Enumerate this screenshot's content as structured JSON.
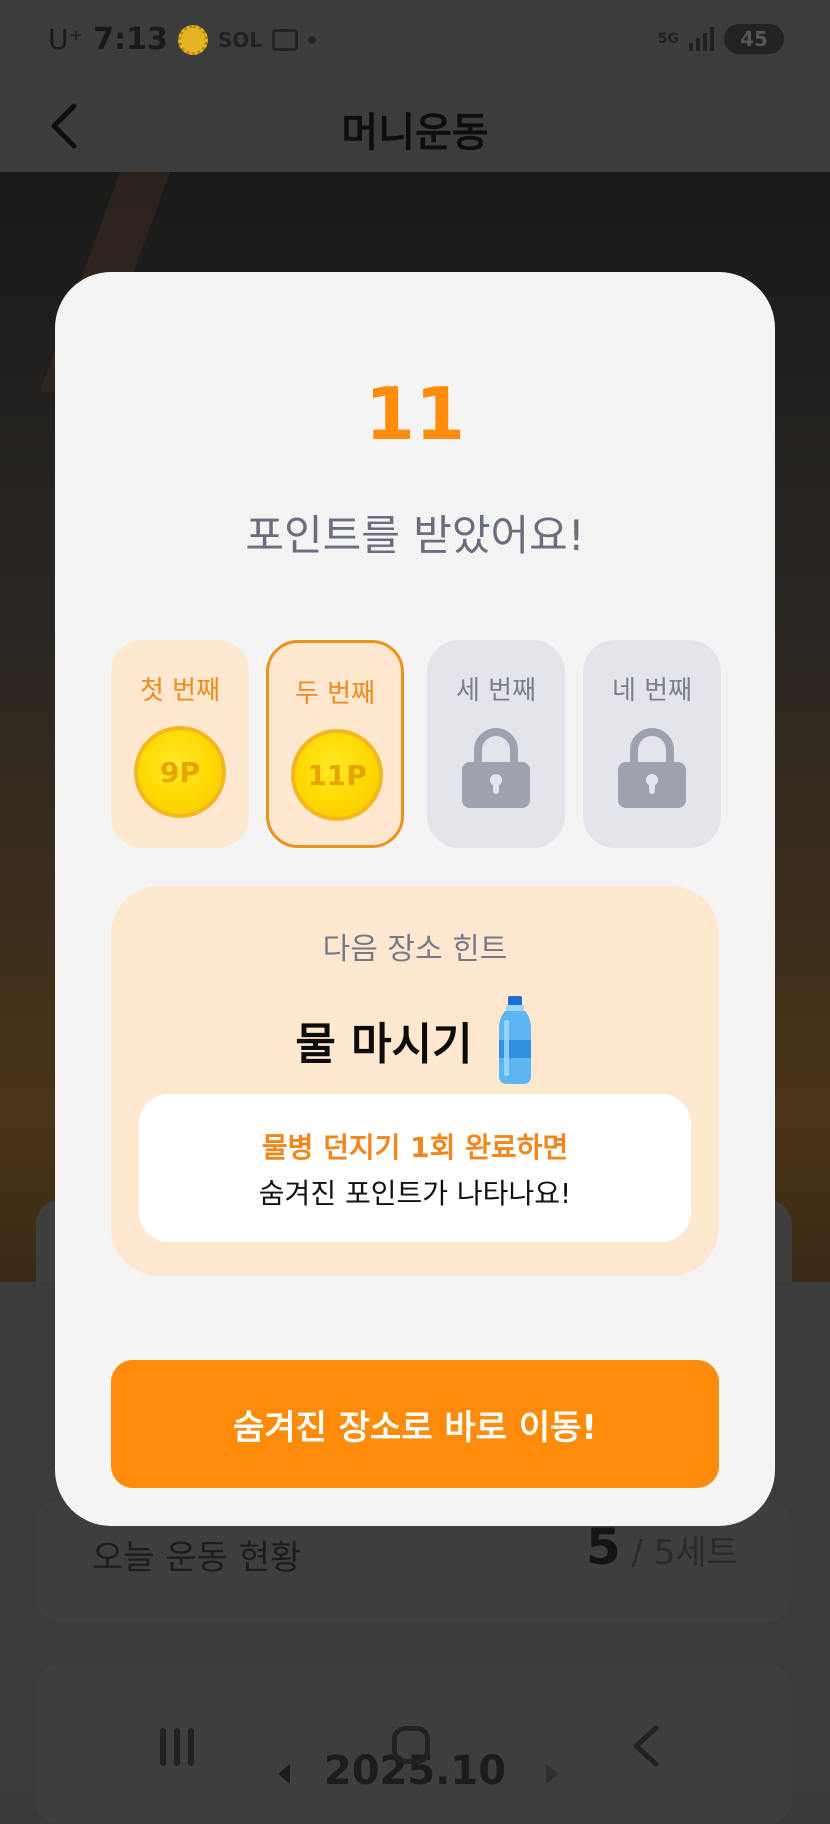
{
  "status_bar": {
    "carrier": "U⁺",
    "time": "7:13",
    "app_badge": "SOL",
    "network": "5G",
    "battery": "45"
  },
  "app_bar": {
    "title": "머니운동"
  },
  "background": {
    "today_label": "오늘 운동 현황",
    "today_done": "5",
    "today_total": " / 5세트",
    "month": "2025.10"
  },
  "modal": {
    "points": "11",
    "points_caption": "포인트를 받았어요!",
    "slots": [
      {
        "label": "첫 번째",
        "reward": "9P",
        "state": "done"
      },
      {
        "label": "두 번째",
        "reward": "11P",
        "state": "current"
      },
      {
        "label": "세 번째",
        "state": "locked"
      },
      {
        "label": "네 번째",
        "state": "locked"
      }
    ],
    "hint": {
      "title": "다음 장소 힌트",
      "place": "물 마시기",
      "line1": "물병 던지기 1회 완료하면",
      "line2": "숨겨진 포인트가 나타나요!"
    },
    "cta": "숨겨진 장소로 바로 이동!"
  },
  "colors": {
    "accent": "#ff8b0a",
    "hint_bg": "#ffe8cf",
    "locked_bg": "#e4e5ea"
  }
}
